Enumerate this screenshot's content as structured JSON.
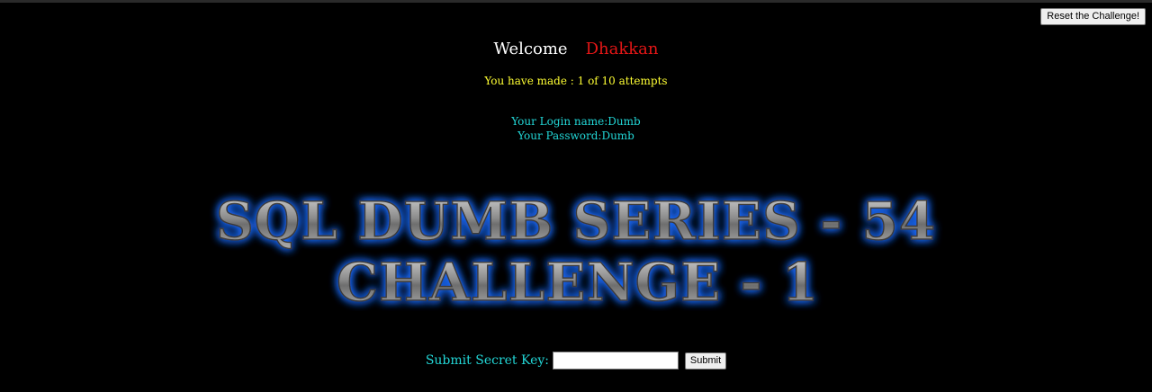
{
  "header": {
    "reset_label": "Reset the Challenge!"
  },
  "welcome": {
    "greeting": "Welcome",
    "user": "Dhakkan"
  },
  "attempts_text": "You have made : 1 of 10 attempts",
  "credentials": {
    "login_line": "Your Login name:Dumb",
    "password_line": "Your Password:Dumb"
  },
  "banner": {
    "line1": "SQL DUMB SERIES - 54",
    "line2": "CHALLENGE - 1"
  },
  "form": {
    "label": "Submit Secret Key:",
    "input_value": "",
    "submit_label": "Submit"
  },
  "colors": {
    "background": "#000000",
    "welcome_text": "#ffffff",
    "user_name": "#e51616",
    "attempts": "#ffff33",
    "credentials": "#22d6d6",
    "banner_glow": "#1e6cff",
    "banner_fill": "#9a9a9a"
  }
}
